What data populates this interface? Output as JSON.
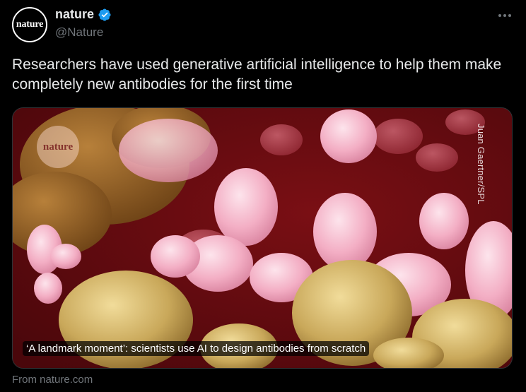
{
  "author": {
    "display_name": "nature",
    "handle": "@Nature",
    "avatar_text": "nature",
    "verified": true
  },
  "tweet": {
    "text": "Researchers have used generative artificial intelligence to help them make completely new antibodies for the first time"
  },
  "card": {
    "watermark_text": "nature",
    "credit": "Juan Gaertner/SPL",
    "title": "‘A landmark moment’: scientists use AI to design antibodies from scratch",
    "source": "From nature.com"
  },
  "icons": {
    "more": "more-horizontal-icon",
    "verified": "verified-badge-icon"
  },
  "colors": {
    "background": "#000000",
    "text_primary": "#e7e9ea",
    "text_secondary": "#71767b",
    "verified_blue": "#1d9bf0",
    "image_background": "#5c0a0f"
  }
}
